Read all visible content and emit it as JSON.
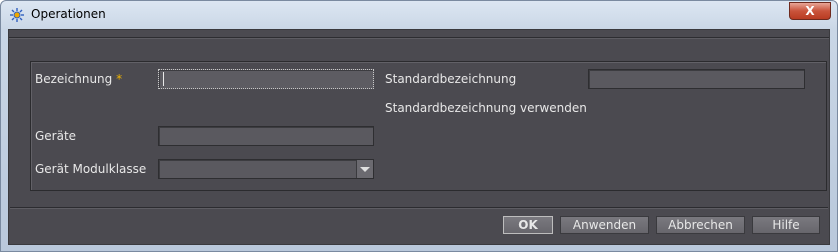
{
  "window": {
    "title": "Operationen",
    "close_label": "X"
  },
  "form": {
    "bezeichnung_label": "Bezeichnung",
    "required_mark": "*",
    "bezeichnung_value": "",
    "standard_label": "Standardbezeichnung",
    "standard_value": "",
    "use_standard_label": "Standardbezeichnung verwenden",
    "geraete_label": "Geräte",
    "geraete_value": "",
    "modulklasse_label": "Gerät Modulklasse",
    "modulklasse_value": ""
  },
  "buttons": {
    "ok": "OK",
    "apply": "Anwenden",
    "cancel": "Abbrechen",
    "help": "Hilfe"
  },
  "colors": {
    "accent": "#f0b400",
    "panel": "#4b4a50"
  }
}
